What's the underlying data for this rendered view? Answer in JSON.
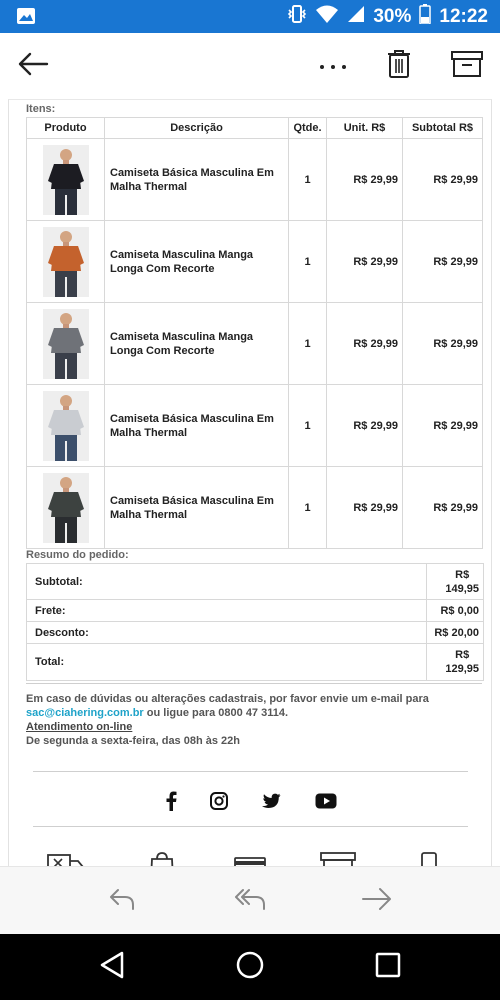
{
  "status_bar": {
    "battery": "30%",
    "time": "12:22"
  },
  "toolbar": {
    "back_icon": "arrow-left-icon",
    "more_icon": "more-horizontal-icon",
    "delete_icon": "trash-icon",
    "archive_icon": "archive-icon"
  },
  "items": {
    "label": "Itens:",
    "headers": {
      "product": "Produto",
      "description": "Descrição",
      "qty": "Qtde.",
      "unit": "Unit. R$",
      "subtotal": "Subtotal R$"
    },
    "rows": [
      {
        "description": "Camiseta Básica Masculina Em Malha Thermal",
        "qty": "1",
        "unit": "R$ 29,99",
        "subtotal": "R$ 29,99",
        "shirt_color": "#1c1c22",
        "pants_color": "#2a2f3a"
      },
      {
        "description": "Camiseta Masculina Manga Longa Com Recorte",
        "qty": "1",
        "unit": "R$ 29,99",
        "subtotal": "R$ 29,99",
        "shirt_color": "#c4622d",
        "pants_color": "#3a3f4a"
      },
      {
        "description": "Camiseta Masculina Manga Longa Com Recorte",
        "qty": "1",
        "unit": "R$ 29,99",
        "subtotal": "R$ 29,99",
        "shirt_color": "#6f7278",
        "pants_color": "#3a3f4a"
      },
      {
        "description": "Camiseta Básica Masculina Em Malha Thermal",
        "qty": "1",
        "unit": "R$ 29,99",
        "subtotal": "R$ 29,99",
        "shirt_color": "#c9ccd1",
        "pants_color": "#3c4f6b"
      },
      {
        "description": "Camiseta Básica Masculina Em Malha Thermal",
        "qty": "1",
        "unit": "R$ 29,99",
        "subtotal": "R$ 29,99",
        "shirt_color": "#3d4240",
        "pants_color": "#2a2d30"
      }
    ]
  },
  "summary": {
    "label": "Resumo do pedido:",
    "subtotal_label": "Subtotal:",
    "subtotal_line1": "R$",
    "subtotal_line2": "149,95",
    "frete_label": "Frete:",
    "frete_value": "R$ 0,00",
    "desconto_label": "Desconto:",
    "desconto_value": "R$ 20,00",
    "total_label": "Total:",
    "total_line1": "R$",
    "total_line2": "129,95"
  },
  "footer": {
    "contact_text": "Em caso de dúvidas ou alterações cadastrais, por favor envie um e-mail para",
    "email": "sac@ciahering.com.br",
    "phone_text": "ou ligue para 0800 47 3114.",
    "online_link": "Atendimento on-line",
    "hours": "De segunda a sexta-feira, das 08h às 22h"
  },
  "social": [
    "facebook-icon",
    "instagram-icon",
    "twitter-icon",
    "youtube-icon"
  ],
  "colors": {
    "status_bar": "#1976d2",
    "link": "#1fa3c9",
    "nav_bar": "#000000"
  }
}
